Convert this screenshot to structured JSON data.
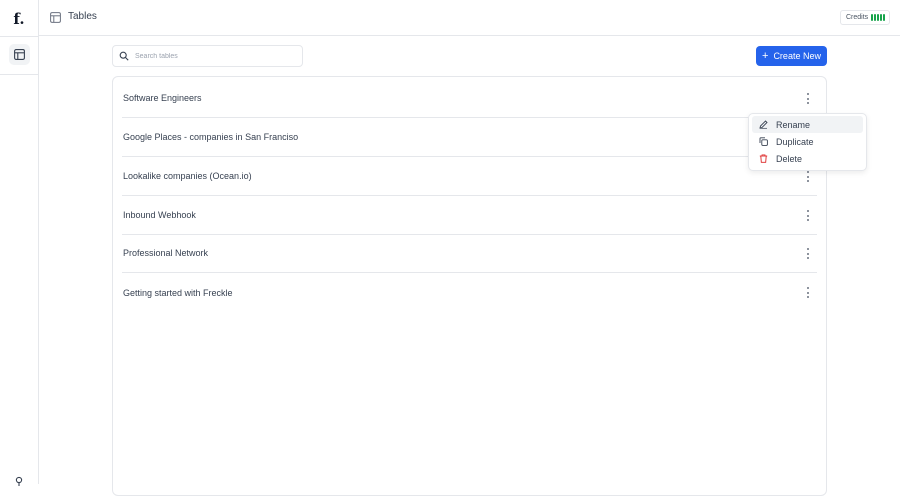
{
  "app": {
    "logo_text": "f."
  },
  "header": {
    "breadcrumb_label": "Tables",
    "credits_label": "Credits"
  },
  "search": {
    "placeholder": "Search tables",
    "value": ""
  },
  "toolbar": {
    "create_label": "Create New"
  },
  "tables": [
    {
      "name": "Software Engineers"
    },
    {
      "name": "Google Places - companies in San Franciso"
    },
    {
      "name": "Lookalike companies (Ocean.io)"
    },
    {
      "name": "Inbound Webhook"
    },
    {
      "name": "Professional Network"
    },
    {
      "name": "Getting started with Freckle"
    }
  ],
  "context_menu": {
    "items": [
      {
        "label": "Rename",
        "icon": "pencil-icon"
      },
      {
        "label": "Duplicate",
        "icon": "copy-icon"
      },
      {
        "label": "Delete",
        "icon": "trash-icon",
        "color": "#dc2626"
      }
    ]
  },
  "colors": {
    "accent": "#2563eb",
    "credits_bar": "#16a34a",
    "danger": "#dc2626"
  }
}
